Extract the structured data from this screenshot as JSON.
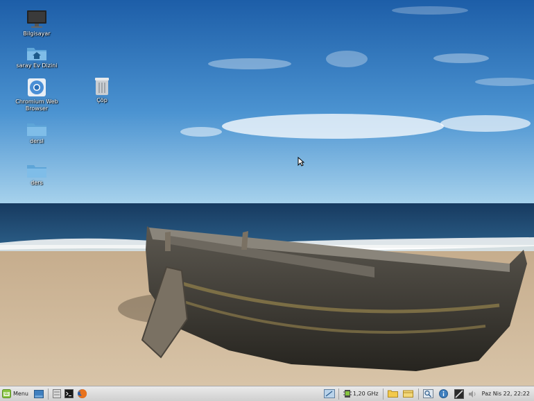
{
  "desktop": {
    "icons": [
      {
        "label": "Bilgisayar",
        "icon": "computer-icon"
      },
      {
        "label": "saray Ev Dizini",
        "icon": "home-folder-icon"
      },
      {
        "label": "Chromium Web Browser",
        "icon": "chromium-icon"
      },
      {
        "label": "dersl",
        "icon": "folder-icon"
      },
      {
        "label": "ders",
        "icon": "folder-icon"
      },
      {
        "label": "Çöp",
        "icon": "trash-icon"
      }
    ]
  },
  "panel": {
    "menu_label": "Menu",
    "launchers": [
      "show-desktop-icon",
      "file-manager-icon",
      "terminal-icon",
      "firefox-icon"
    ],
    "cpu_freq": "1,20 GHz",
    "clock": "Paz Nis 22, 22:22"
  },
  "colors": {
    "sky_top": "#1d5ea8",
    "sky_horizon": "#a7d2ec",
    "sea": "#1b3f66",
    "sand": "#cfb89b",
    "panel": "#dcdcdc",
    "mint_accent": "#87c540"
  }
}
